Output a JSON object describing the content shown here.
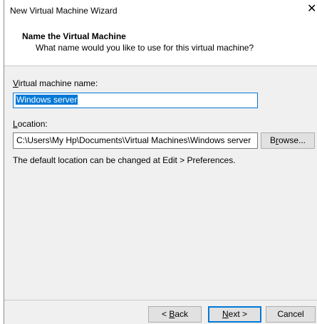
{
  "window": {
    "title": "New Virtual Machine Wizard",
    "close_glyph": "✕"
  },
  "header": {
    "title": "Name the Virtual Machine",
    "subtitle": "What name would you like to use for this virtual machine?"
  },
  "vm_name": {
    "label_mnemonic": "V",
    "label_rest": "irtual machine name:",
    "value": "Windows server"
  },
  "location": {
    "label_mnemonic": "L",
    "label_rest": "ocation:",
    "value": "C:\\Users\\My Hp\\Documents\\Virtual Machines\\Windows server",
    "browse_mnemonic_before": "B",
    "browse_mnemonic": "r",
    "browse_after": "owse...",
    "hint": "The default location can be changed at Edit > Preferences."
  },
  "footer": {
    "back_prefix": "< ",
    "back_mnemonic": "B",
    "back_rest": "ack",
    "next_mnemonic": "N",
    "next_rest": "ext >",
    "cancel_label": "Cancel"
  },
  "colors": {
    "accent": "#0078d7",
    "dialog_bg": "#f0f0f0",
    "button_bg": "#e1e1e1"
  }
}
